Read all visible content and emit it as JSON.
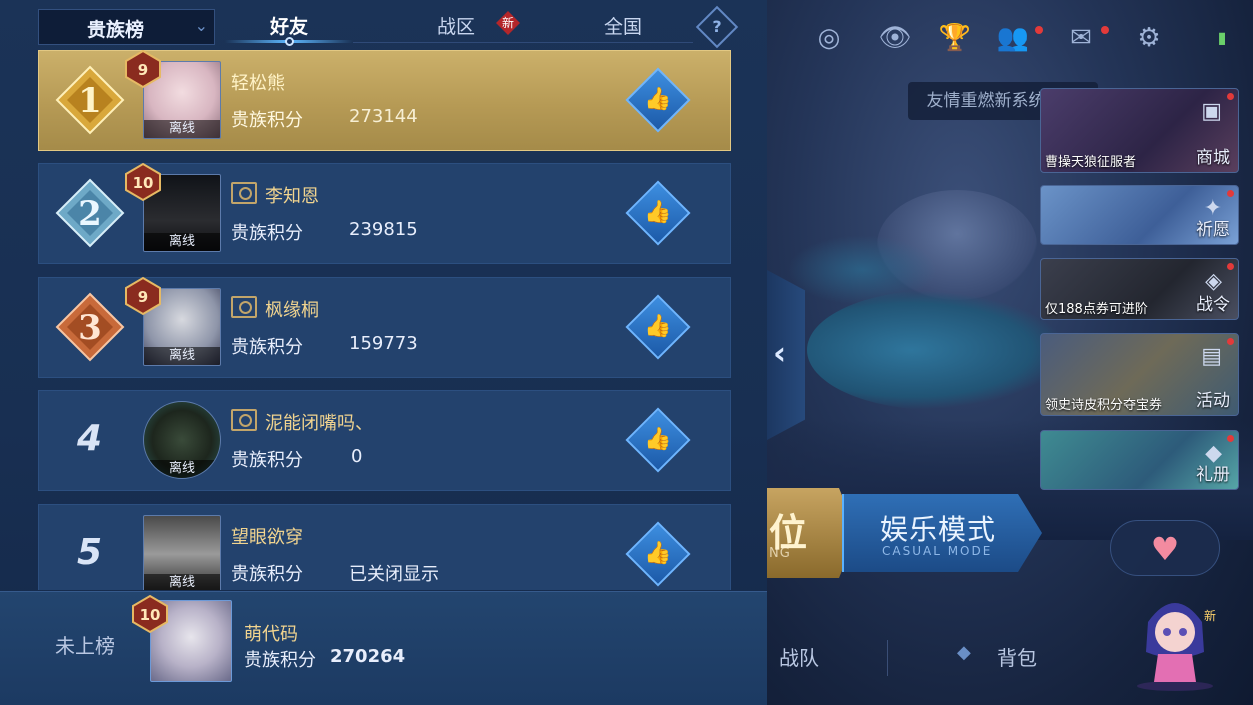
{
  "panel": {
    "dropdown_label": "贵族榜",
    "tabs": [
      {
        "label": "好友",
        "active": true
      },
      {
        "label": "战区",
        "badge": "新"
      },
      {
        "label": "全国"
      }
    ],
    "help_label": "?",
    "score_label": "贵族积分",
    "offline_label": "离线",
    "entries": [
      {
        "rank": "1",
        "level": "9",
        "name": "轻松熊",
        "score": "273144",
        "noble_badge": false
      },
      {
        "rank": "2",
        "level": "10",
        "name": "李知恩",
        "score": "239815",
        "noble_badge": true
      },
      {
        "rank": "3",
        "level": "9",
        "name": "枫缘桐",
        "score": "159773",
        "noble_badge": true
      },
      {
        "rank": "4",
        "level": "",
        "name": "泥能闭嘴吗、",
        "score": "0",
        "noble_badge": true
      },
      {
        "rank": "5",
        "level": "",
        "name": "望眼欲穿",
        "score": "已关闭显示",
        "noble_badge": false
      }
    ],
    "mine": {
      "status": "未上榜",
      "level": "10",
      "name": "萌代码",
      "score": "270264"
    },
    "like_icon": "thumbs-up-icon"
  },
  "game": {
    "tooltip": "友情重燃新系统上线",
    "side_cards": [
      {
        "caption": "曹操天狼征服者",
        "label": "商城"
      },
      {
        "caption": "",
        "label": "祈愿"
      },
      {
        "caption": "仅188点券可进阶",
        "label": "战令"
      },
      {
        "caption": "领史诗皮积分夺宝券",
        "label": "活动"
      },
      {
        "caption": "",
        "label": "礼册"
      }
    ],
    "mode_rank": {
      "text": "位",
      "sub": "NG"
    },
    "mode_casual": {
      "text": "娱乐模式",
      "sub": "CASUAL MODE"
    },
    "bottom_nav": [
      "战队",
      "背包"
    ],
    "chibi_badge": "新",
    "colors": {
      "gold_row": "#c8ad67",
      "row_blue": "#23426d",
      "accent_blue": "#3d8ee0"
    }
  }
}
